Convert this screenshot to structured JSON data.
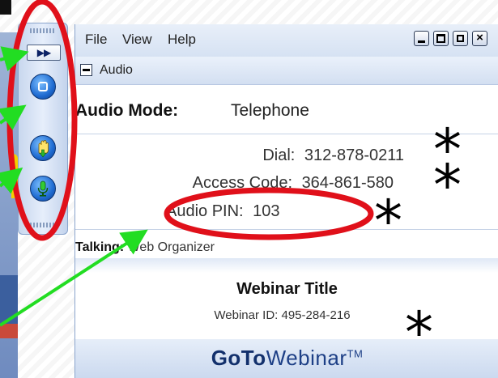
{
  "menu": {
    "file": "File",
    "view": "View",
    "help": "Help",
    "close_glyph": "×"
  },
  "audio": {
    "section_label": "Audio",
    "mode_label": "Audio Mode:",
    "mode_value": "Telephone",
    "dial_label": "Dial:",
    "dial_value": "312-878-0211",
    "access_label": "Access Code:",
    "access_value": "364-861-580",
    "pin_label": "Audio PIN:",
    "pin_value": "103",
    "talking_label": "Talking:",
    "talking_value": "Web Organizer"
  },
  "webinar": {
    "title": "Webinar Title",
    "id_label": "Webinar ID:",
    "id_value": "495-284-216"
  },
  "brand": {
    "goto": "GoTo",
    "webinar": "Webinar",
    "tm": "TM"
  },
  "grabtab": {
    "expand_glyph": "▶▶"
  },
  "annotations": {
    "asterisk": "*"
  },
  "colors": {
    "highlight_red": "#e0101a",
    "arrow_green": "#22dd22",
    "brand_blue": "#1d3f86"
  }
}
